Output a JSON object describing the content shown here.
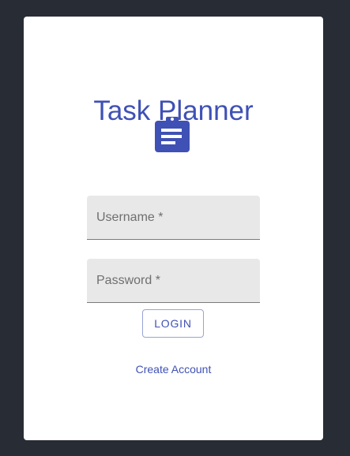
{
  "app": {
    "title": "Task Planner",
    "logo_icon": "clipboard-list-icon",
    "accent_color": "#3f51b5",
    "background_color": "#282c34"
  },
  "form": {
    "username": {
      "label": "Username *",
      "value": ""
    },
    "password": {
      "label": "Password *",
      "value": ""
    },
    "login_label": "LOGIN",
    "create_account_label": "Create Account"
  }
}
